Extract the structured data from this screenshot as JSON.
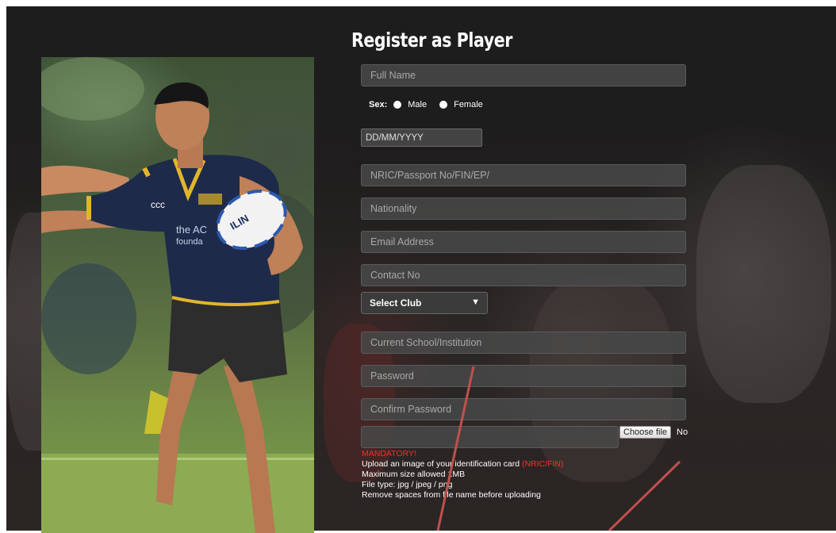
{
  "form": {
    "title": "Register as Player",
    "full_name_placeholder": "Full Name",
    "sex_label": "Sex:",
    "sex_options": [
      "Male",
      "Female"
    ],
    "dob_placeholder": "DD/MM/YYYY",
    "nric_placeholder": "NRIC/Passport No/FIN/EP/",
    "nationality_placeholder": "Nationality",
    "email_placeholder": "Email Address",
    "contact_placeholder": "Contact No",
    "club_select": "Select Club",
    "school_placeholder": "Current School/Institution",
    "password_placeholder": "Password",
    "confirm_password_placeholder": "Confirm Password",
    "choose_file_label": "Choose file",
    "no_file_text": "No"
  },
  "upload_info": {
    "mandatory": "MANDATORY!",
    "line1_prefix": "Upload an image of your identification card ",
    "line1_highlight": "(NRIC/FIN)",
    "line2": "Maximum size allowed 1MB",
    "line3": "File type: jpg / jpeg / png",
    "line4": "Remove spaces from file name before uploading"
  },
  "photo": {
    "jersey_text": "the AC",
    "jersey_text2": "founda",
    "ball_text": "ILIN"
  },
  "colors": {
    "accent_red": "#ff2a2a",
    "arrow": "#c0504d"
  }
}
